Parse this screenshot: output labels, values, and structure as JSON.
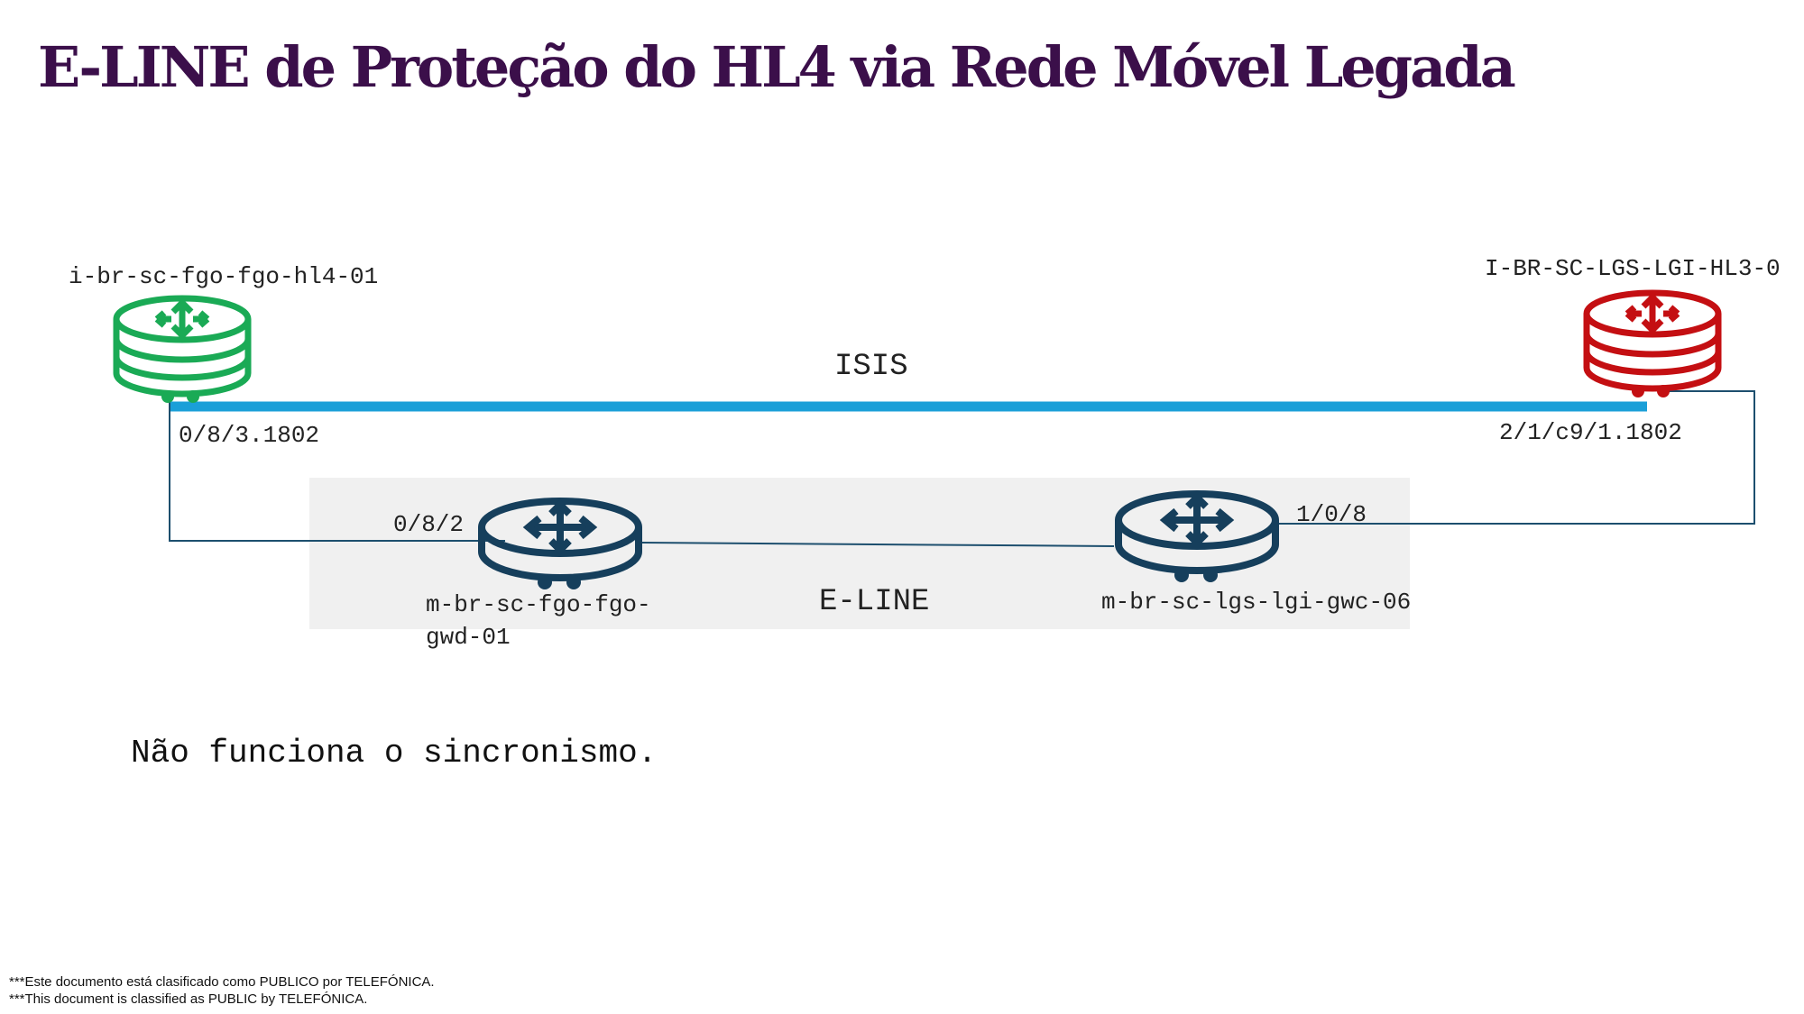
{
  "title": "E-LINE de Proteção do HL4 via Rede Móvel Legada",
  "nodes": {
    "hl4": {
      "name": "i-br-sc-fgo-fgo-hl4-01",
      "color": "#1aaa55"
    },
    "hl3": {
      "name": "I-BR-SC-LGS-LGI-HL3-0",
      "color": "#c40f12"
    },
    "gwd": {
      "name_line1": "m-br-sc-fgo-fgo-",
      "name_line2": "gwd-01",
      "color": "#163f5c"
    },
    "gwc": {
      "name": "m-br-sc-lgs-lgi-gwc-06",
      "color": "#163f5c"
    }
  },
  "ports": {
    "hl4": "0/8/3.1802",
    "hl3": "2/1/c9/1.1802",
    "gwd": "0/8/2",
    "gwc": "1/0/8"
  },
  "links": {
    "isis": {
      "label": "ISIS",
      "color": "#1a9fd8"
    },
    "eline": {
      "label": "E-LINE"
    }
  },
  "status_text": "Não funciona o sincronismo.",
  "footer": {
    "line1": "***Este documento está clasificado como PUBLICO por TELEFÓNICA.",
    "line2": "***This document is classified as PUBLIC by TELEFÓNICA."
  }
}
